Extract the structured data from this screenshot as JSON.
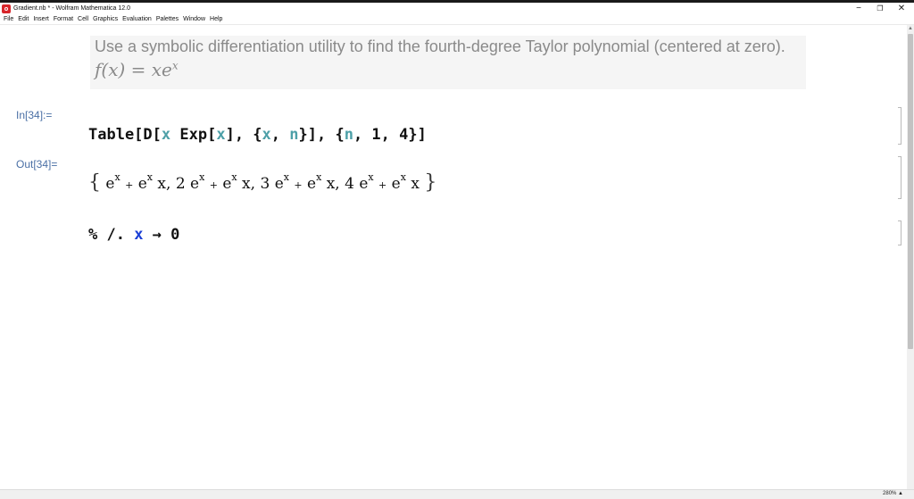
{
  "window": {
    "title": "Gradient.nb * - Wolfram Mathematica 12.0",
    "minimize_glyph": "−",
    "restore_glyph": "❐",
    "close_glyph": "✕"
  },
  "menu": {
    "items": [
      "File",
      "Edit",
      "Insert",
      "Format",
      "Cell",
      "Graphics",
      "Evaluation",
      "Palettes",
      "Window",
      "Help"
    ]
  },
  "notebook": {
    "question": "Use a symbolic differentiation utility to find the fourth-degree Taylor polynomial (centered at zero).",
    "formula": "f(x) = xe",
    "formula_exp": "x",
    "input_label": "In[34]:=",
    "output_label": "Out[34]=",
    "output_terms": [
      {
        "coef": "",
        "func": "e",
        "exp": "x",
        "plus": "+",
        "tail": "x",
        "sep": ","
      },
      {
        "coef": "2",
        "func": "e",
        "exp": "x",
        "plus": "+",
        "tail": "x",
        "sep": ","
      },
      {
        "coef": "3",
        "func": "e",
        "exp": "x",
        "plus": "+",
        "tail": "x",
        "sep": ","
      },
      {
        "coef": "4",
        "func": "e",
        "exp": "x",
        "plus": "+",
        "tail": "x",
        "sep": ""
      }
    ],
    "output_open": "{",
    "output_close": "}"
  },
  "status": {
    "zoom": "280%",
    "zoom_arrow": "▲"
  },
  "colors": {
    "label": "#4a6fa5",
    "variable": "#4da0a8",
    "pattern": "#1b3fd6",
    "text_cell_bg": "#f5f5f5"
  }
}
